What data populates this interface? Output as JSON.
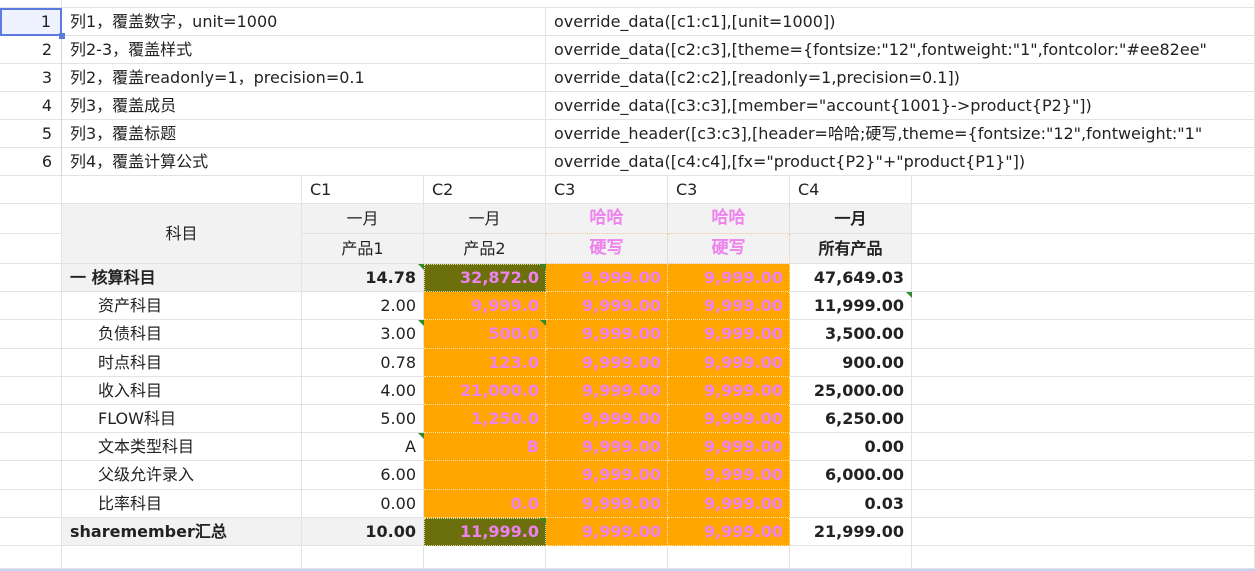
{
  "notes": [
    {
      "num": "1",
      "label": "列1，覆盖数字，unit=1000",
      "code": "override_data([c1:c1],[unit=1000])"
    },
    {
      "num": "2",
      "label": "列2-3，覆盖样式",
      "code": "override_data([c2:c3],[theme={fontsize:\"12\",fontweight:\"1\",fontcolor:\"#ee82ee\""
    },
    {
      "num": "3",
      "label": "列2，覆盖readonly=1，precision=0.1",
      "code": "override_data([c2:c2],[readonly=1,precision=0.1])"
    },
    {
      "num": "4",
      "label": "列3，覆盖成员",
      "code": "override_data([c3:c3],[member=\"account{1001}->product{P2}\"])"
    },
    {
      "num": "5",
      "label": "列3，覆盖标题",
      "code": "override_header([c3:c3],[header=哈哈;硬写,theme={fontsize:\"12\",fontweight:\"1\""
    },
    {
      "num": "6",
      "label": "列4，覆盖计算公式",
      "code": "override_data([c4:c4],[fx=\"product{P2}\"+\"product{P1}\"])"
    }
  ],
  "col_codes": [
    "C1",
    "C2",
    "C3",
    "C3",
    "C4"
  ],
  "table": {
    "subject_header": "科目",
    "headers": [
      {
        "top": "一月",
        "bottom": "产品1"
      },
      {
        "top": "一月",
        "bottom": "产品2"
      },
      {
        "top": "哈哈",
        "bottom": "硬写"
      },
      {
        "top": "哈哈",
        "bottom": "硬写"
      },
      {
        "top": "一月",
        "bottom": "所有产品"
      }
    ],
    "rows": [
      {
        "subject": "一 核算科目",
        "c1": "14.78",
        "c2": "32,872.0",
        "c3a": "9,999.00",
        "c3b": "9,999.00",
        "c4": "47,649.03"
      },
      {
        "subject": "资产科目",
        "c1": "2.00",
        "c2": "9,999.0",
        "c3a": "9,999.00",
        "c3b": "9,999.00",
        "c4": "11,999.00"
      },
      {
        "subject": "负债科目",
        "c1": "3.00",
        "c2": "500.0",
        "c3a": "9,999.00",
        "c3b": "9,999.00",
        "c4": "3,500.00"
      },
      {
        "subject": "时点科目",
        "c1": "0.78",
        "c2": "123.0",
        "c3a": "9,999.00",
        "c3b": "9,999.00",
        "c4": "900.00"
      },
      {
        "subject": "收入科目",
        "c1": "4.00",
        "c2": "21,000.0",
        "c3a": "9,999.00",
        "c3b": "9,999.00",
        "c4": "25,000.00"
      },
      {
        "subject": "FLOW科目",
        "c1": "5.00",
        "c2": "1,250.0",
        "c3a": "9,999.00",
        "c3b": "9,999.00",
        "c4": "6,250.00"
      },
      {
        "subject": "文本类型科目",
        "c1": "A",
        "c2": "B",
        "c3a": "9,999.00",
        "c3b": "9,999.00",
        "c4": "0.00"
      },
      {
        "subject": "父级允许录入",
        "c1": "6.00",
        "c2": "",
        "c3a": "9,999.00",
        "c3b": "9,999.00",
        "c4": "6,000.00"
      },
      {
        "subject": "比率科目",
        "c1": "0.00",
        "c2": "0.0",
        "c3a": "9,999.00",
        "c3b": "9,999.00",
        "c4": "0.03"
      },
      {
        "subject": "sharemember汇总",
        "c1": "10.00",
        "c2": "11,999.0",
        "c3a": "9,999.00",
        "c3b": "9,999.00",
        "c4": "21,999.00"
      }
    ]
  },
  "colors": {
    "orange": "#ffa500",
    "olive": "#6b6f0c",
    "pink": "#ee82ee",
    "selection": "#5b7be0",
    "comment_marker": "#2e8b2e"
  }
}
